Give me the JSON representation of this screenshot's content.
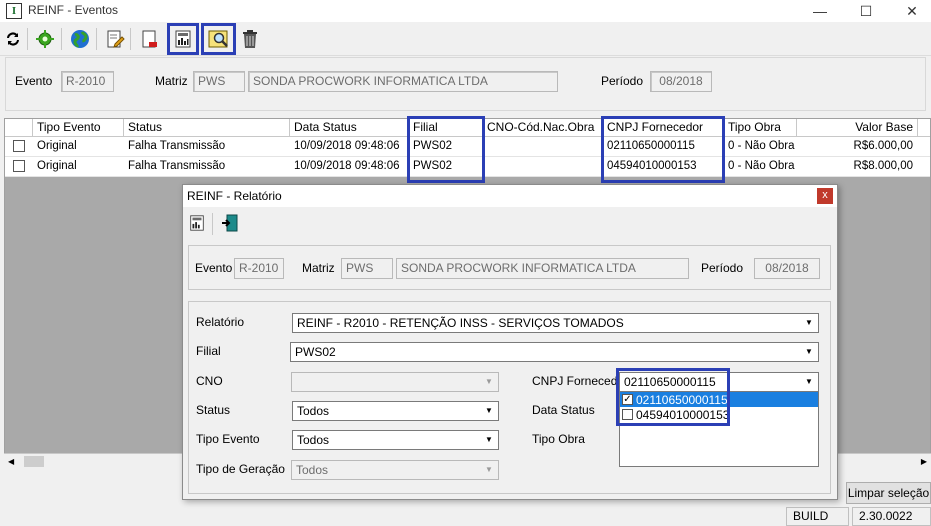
{
  "window": {
    "title": "REINF - Eventos",
    "app_icon": "I",
    "minimize": "—",
    "maximize": "☐",
    "close": "✕"
  },
  "toolbar": {
    "icons": [
      "refresh-icon",
      "process-gear-icon",
      "globe-icon",
      "edit-document-icon",
      "pdf-document-icon",
      "report-icon",
      "search-icon",
      "delete-trash-icon"
    ]
  },
  "header": {
    "evento_label": "Evento",
    "evento_value": "R-2010",
    "matriz_label": "Matriz",
    "matriz_code": "PWS",
    "matriz_name": "SONDA PROCWORK INFORMATICA LTDA",
    "periodo_label": "Período",
    "periodo_value": "08/2018"
  },
  "grid": {
    "columns": [
      "Tipo Evento",
      "Status",
      "Data Status",
      "Filial",
      "CNO-Cód.Nac.Obra",
      "CNPJ Fornecedor",
      "Tipo Obra",
      "Valor Base"
    ],
    "rows": [
      {
        "tipo": "Original",
        "status": "Falha Transmissão",
        "data": "10/09/2018 09:48:06",
        "filial": "PWS02",
        "cno": "",
        "cnpj": "02110650000115",
        "tipo_obra": "0 - Não Obra",
        "valor": "R$6.000,00"
      },
      {
        "tipo": "Original",
        "status": "Falha Transmissão",
        "data": "10/09/2018 09:48:06",
        "filial": "PWS02",
        "cno": "",
        "cnpj": "04594010000153",
        "tipo_obra": "0 - Não Obra",
        "valor": "R$8.000,00"
      }
    ]
  },
  "bottom": {
    "limpar": "Limpar seleção",
    "build_label": "BUILD",
    "build_value": "2.30.0022"
  },
  "dialog": {
    "title": "REINF - Relatório",
    "close": "x",
    "evento_label": "Evento",
    "evento_value": "R-2010",
    "matriz_label": "Matriz",
    "matriz_code": "PWS",
    "matriz_name": "SONDA PROCWORK INFORMATICA LTDA",
    "periodo_label": "Período",
    "periodo_value": "08/2018",
    "relatorio_label": "Relatório",
    "relatorio_value": "REINF - R2010 - RETENÇÃO INSS - SERVIÇOS TOMADOS",
    "filial_label": "Filial",
    "filial_value": "PWS02",
    "cno_label": "CNO",
    "cno_value": "",
    "status_label": "Status",
    "status_value": "Todos",
    "tipo_evento_label": "Tipo Evento",
    "tipo_evento_value": "Todos",
    "tipo_geracao_label": "Tipo de Geração",
    "tipo_geracao_value": "Todos",
    "cnpj_label": "CNPJ Fornecedor",
    "cnpj_value": "02110650000115",
    "cnpj_options": [
      {
        "label": "02110650000115",
        "checked": true
      },
      {
        "label": "04594010000153",
        "checked": false
      }
    ],
    "data_status_label": "Data Status",
    "tipo_obra_label": "Tipo Obra"
  },
  "colors": {
    "highlight": "#2b3fb5",
    "selection": "#1a7fe0",
    "close_red": "#c0392b"
  }
}
